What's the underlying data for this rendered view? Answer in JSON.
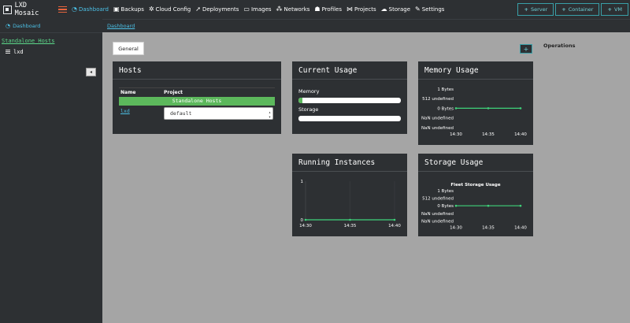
{
  "app": {
    "title": "LXD Mosaic"
  },
  "nav": {
    "items": [
      {
        "icon": "dashboard-icon",
        "glyph": "◔",
        "label": "Dashboard"
      },
      {
        "icon": "backups-icon",
        "glyph": "▣",
        "label": "Backups"
      },
      {
        "icon": "cloud-config-icon",
        "glyph": "✲",
        "label": "Cloud Config"
      },
      {
        "icon": "deployments-icon",
        "glyph": "➚",
        "label": "Deployments"
      },
      {
        "icon": "images-icon",
        "glyph": "▭",
        "label": "Images"
      },
      {
        "icon": "networks-icon",
        "glyph": "⁂",
        "label": "Networks"
      },
      {
        "icon": "profiles-icon",
        "glyph": "☗",
        "label": "Profiles"
      },
      {
        "icon": "projects-icon",
        "glyph": "⋈",
        "label": "Projects"
      },
      {
        "icon": "storage-icon",
        "glyph": "☁",
        "label": "Storage"
      },
      {
        "icon": "settings-icon",
        "glyph": "✎",
        "label": "Settings"
      }
    ],
    "actions": [
      "Server",
      "Container",
      "VM"
    ]
  },
  "sidebar": {
    "dashboard_label": "Dashboard",
    "group_label": "Standalone Hosts",
    "hosts": [
      "lxd"
    ],
    "collapse_glyph": "◂"
  },
  "breadcrumb": {
    "current": "Dashboard"
  },
  "tabs": [
    "General"
  ],
  "operations": {
    "title": "Operations",
    "add_label": "+"
  },
  "hosts_card": {
    "title": "Hosts",
    "columns": [
      "Name",
      "Project"
    ],
    "group_row": "Standalone Hosts",
    "rows": [
      {
        "name": "lxd",
        "project": "default"
      }
    ]
  },
  "current_usage": {
    "title": "Current Usage",
    "memory_label": "Memory",
    "memory_fraction": 0.04,
    "storage_label": "Storage",
    "storage_fraction": 0.0
  },
  "memory_usage": {
    "title": "Memory Usage",
    "chart_title": "",
    "y_ticks": [
      "1 Bytes",
      "512 undefined",
      "0 Bytes",
      "NaN undefined",
      "NaN undefined"
    ],
    "x_ticks": [
      "14:30",
      "14:35",
      "14:40"
    ]
  },
  "running_instances": {
    "title": "Running Instances",
    "chart_title": "",
    "y_ticks": [
      "1",
      "0"
    ],
    "x_ticks": [
      "14:30",
      "14:35",
      "14:40"
    ]
  },
  "storage_usage": {
    "title": "Storage Usage",
    "chart_title": "Fleet Storage Usage",
    "y_ticks": [
      "1 Bytes",
      "512 undefined",
      "0 Bytes",
      "NaN undefined",
      "NaN undefined"
    ],
    "x_ticks": [
      "14:30",
      "14:35",
      "14:40"
    ]
  },
  "colors": {
    "accent": "#4cc0e6",
    "success": "#5cb85c",
    "line": "#3fd37b",
    "panel": "#2d3033",
    "background": "#a5a5a5"
  },
  "chart_data": [
    {
      "type": "line",
      "title": "",
      "x": [
        "14:30",
        "14:35",
        "14:40"
      ],
      "series": [
        {
          "values": [
            0,
            0,
            0
          ]
        }
      ],
      "y_tick_labels": [
        "1 Bytes",
        "512 undefined",
        "0 Bytes",
        "NaN undefined",
        "NaN undefined"
      ],
      "grid": false
    },
    {
      "type": "line",
      "title": "",
      "x": [
        "14:30",
        "14:35",
        "14:40"
      ],
      "series": [
        {
          "values": [
            0,
            0,
            0
          ]
        }
      ],
      "ylim": [
        0,
        1
      ],
      "y_tick_labels": [
        "1",
        "0"
      ],
      "grid": true
    },
    {
      "type": "line",
      "title": "Fleet Storage Usage",
      "x": [
        "14:30",
        "14:35",
        "14:40"
      ],
      "series": [
        {
          "values": [
            0,
            0,
            0
          ]
        }
      ],
      "y_tick_labels": [
        "1 Bytes",
        "512 undefined",
        "0 Bytes",
        "NaN undefined",
        "NaN undefined"
      ],
      "grid": false
    }
  ]
}
